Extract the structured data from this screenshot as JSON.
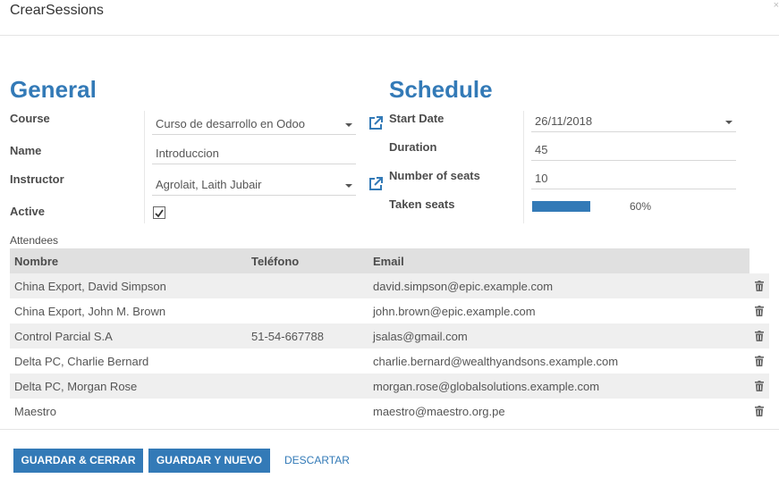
{
  "modal": {
    "title": "CrearSessions"
  },
  "general": {
    "title": "General",
    "course_label": "Course",
    "course_value": "Curso de desarrollo en Odoo",
    "name_label": "Name",
    "name_value": "Introduccion",
    "instructor_label": "Instructor",
    "instructor_value": "Agrolait, Laith Jubair",
    "active_label": "Active",
    "active_checked": true
  },
  "schedule": {
    "title": "Schedule",
    "start_date_label": "Start Date",
    "start_date_value": "26/11/2018",
    "duration_label": "Duration",
    "duration_value": "45",
    "seats_label": "Number of seats",
    "seats_value": "10",
    "taken_label": "Taken seats",
    "taken_percent": 60,
    "taken_text": "60%"
  },
  "attendees": {
    "label": "Attendees",
    "columns": [
      "Nombre",
      "Teléfono",
      "Email"
    ],
    "rows": [
      {
        "name": "China Export, David Simpson",
        "phone": "",
        "email": "david.simpson@epic.example.com"
      },
      {
        "name": "China Export, John M. Brown",
        "phone": "",
        "email": "john.brown@epic.example.com"
      },
      {
        "name": "Control Parcial S.A",
        "phone": "51-54-667788",
        "email": "jsalas@gmail.com"
      },
      {
        "name": "Delta PC, Charlie Bernard",
        "phone": "",
        "email": "charlie.bernard@wealthyandsons.example.com"
      },
      {
        "name": "Delta PC, Morgan Rose",
        "phone": "",
        "email": "morgan.rose@globalsolutions.example.com"
      },
      {
        "name": "Maestro",
        "phone": "",
        "email": "maestro@maestro.org.pe"
      }
    ]
  },
  "footer": {
    "save_close": "GUARDAR & CERRAR",
    "save_new": "GUARDAR Y NUEVO",
    "discard": "DESCARTAR"
  },
  "colors": {
    "accent": "#337ab7",
    "row_alt": "#efefef",
    "header_bg": "#e0e0e0"
  },
  "icons": [
    "external-link-icon",
    "checkbox-checked-icon",
    "trash-icon",
    "close-icon"
  ]
}
